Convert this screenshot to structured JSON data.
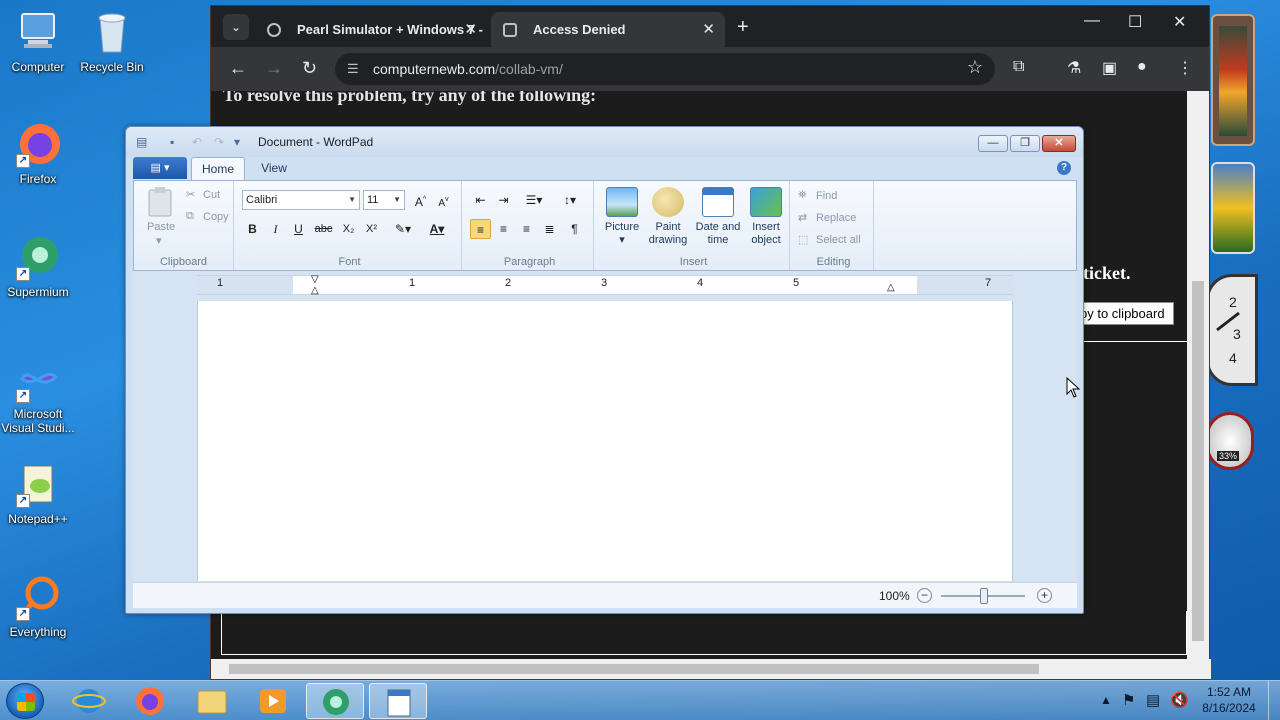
{
  "desktop": {
    "icons": [
      {
        "label": "Computer",
        "icon": "computer-icon"
      },
      {
        "label": "Recycle Bin",
        "icon": "recycle-bin-icon"
      },
      {
        "label": "Firefox",
        "icon": "firefox-icon"
      },
      {
        "label": "Supermium",
        "icon": "supermium-icon"
      },
      {
        "label": "Microsoft Visual Studi...",
        "icon": "visual-studio-icon"
      },
      {
        "label": "Notepad++",
        "icon": "notepadpp-icon"
      },
      {
        "label": "Everything",
        "icon": "everything-icon"
      }
    ]
  },
  "browser": {
    "tabs": [
      {
        "title": "Pearl Simulator + Windows 7 -",
        "icon": "globe-icon"
      },
      {
        "title": "Access Denied",
        "icon": "access-denied-icon"
      }
    ],
    "url_host": "computernewb.com",
    "url_path": "/collab-vm/",
    "page": {
      "heading": "To resolve this problem, try any of the following:",
      "ticket_text": "ticket.",
      "copy_button": "py to clipboard"
    }
  },
  "wordpad": {
    "title": "Document - WordPad",
    "tabs": [
      "Home",
      "View"
    ],
    "clipboard": {
      "paste": "Paste",
      "cut": "Cut",
      "copy": "Copy",
      "label": "Clipboard"
    },
    "font": {
      "family": "Calibri",
      "size": "11",
      "label": "Font"
    },
    "paragraph": {
      "label": "Paragraph"
    },
    "insert": {
      "picture": "Picture",
      "paint_1": "Paint",
      "paint_2": "drawing",
      "date_1": "Date and",
      "date_2": "time",
      "object_1": "Insert",
      "object_2": "object",
      "label": "Insert"
    },
    "editing": {
      "find": "Find",
      "replace": "Replace",
      "select_all": "Select all",
      "label": "Editing"
    },
    "ruler_numbers": [
      "1",
      "1",
      "2",
      "3",
      "4",
      "5",
      "7"
    ],
    "zoom": "100%"
  },
  "taskbar": {
    "items": [
      "start",
      "internet-explorer",
      "firefox",
      "file-explorer",
      "media-player",
      "supermium",
      "wordpad"
    ],
    "time": "1:52 AM",
    "date": "8/16/2024"
  },
  "gadgets": {
    "cpu_percent": "33%"
  }
}
